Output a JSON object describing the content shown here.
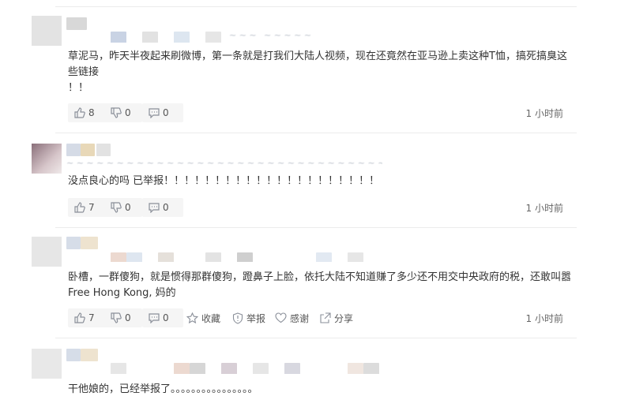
{
  "comments": [
    {
      "text": "草泥马，昨天半夜起来刷微博，第一条就是打我们大陆人视频，现在还竟然在亚马逊上卖这种T恤，搞死搞臭这些链接\n！！",
      "like": "8",
      "dislike": "0",
      "reply": "0",
      "time": "1 小时前"
    },
    {
      "text": "没点良心的吗  已举报！！！！！！！！！！！！！！！！！！！！！",
      "like": "7",
      "dislike": "0",
      "reply": "0",
      "time": "1 小时前"
    },
    {
      "text": "卧槽，一群傻狗，就是惯得那群傻狗，蹬鼻子上脸，依托大陆不知道赚了多少还不用交中央政府的税，还敢叫嚣Free Hong Kong, 妈的",
      "like": "7",
      "dislike": "0",
      "reply": "0",
      "collect": "收藏",
      "report": "举报",
      "thanks": "感谢",
      "share": "分享",
      "time": "1 小时前"
    },
    {
      "text": "干他娘的，已经举报了。。。。。。。。。。。。。。。。"
    }
  ],
  "colors": {
    "divider": "#ececec",
    "action_bg": "#f5f5f5",
    "icon": "#8a8f99"
  },
  "icons": [
    "thumb-up-icon",
    "thumb-down-icon",
    "comment-icon",
    "star-icon",
    "shield-icon",
    "heart-icon",
    "share-icon"
  ]
}
